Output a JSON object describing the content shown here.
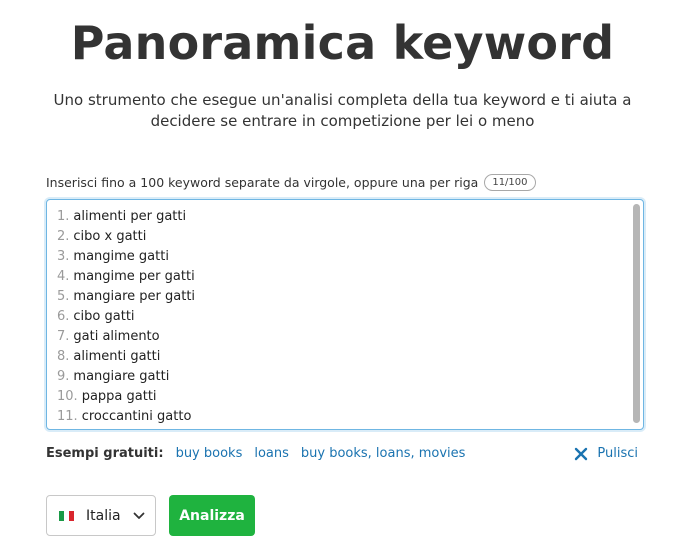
{
  "header": {
    "title": "Panoramica keyword",
    "subtitle_line1": "Uno strumento che esegue un'analisi completa della tua keyword e ti aiuta a",
    "subtitle_line2": "decidere se entrare in competizione per lei o meno"
  },
  "input": {
    "label": "Inserisci fino a 100 keyword separate da virgole, oppure una per riga",
    "counter": "11/100",
    "lines": [
      {
        "num": "1.",
        "text": "alimenti per gatti"
      },
      {
        "num": "2.",
        "text": "cibo x gatti"
      },
      {
        "num": "3.",
        "text": "mangime gatti"
      },
      {
        "num": "4.",
        "text": "mangime per gatti"
      },
      {
        "num": "5.",
        "text": "mangiare per gatti"
      },
      {
        "num": "6.",
        "text": "cibo gatti"
      },
      {
        "num": "7.",
        "text": "gati alimento"
      },
      {
        "num": "8.",
        "text": "alimenti gatti"
      },
      {
        "num": "9.",
        "text": "mangiare gatti"
      },
      {
        "num": "10.",
        "text": "pappa gatti"
      },
      {
        "num": "11.",
        "text": "croccantini gatto"
      }
    ]
  },
  "examples": {
    "label": "Esempi gratuiti:",
    "links": [
      "buy books",
      "loans",
      "buy books, loans, movies"
    ],
    "clear_label": "Pulisci"
  },
  "controls": {
    "country": "Italia",
    "country_icon": "italy-flag-icon",
    "analyze_label": "Analizza"
  },
  "colors": {
    "accent_link": "#1a73b0",
    "primary_button": "#1fb33f",
    "focus_border": "#6fb6e3"
  }
}
